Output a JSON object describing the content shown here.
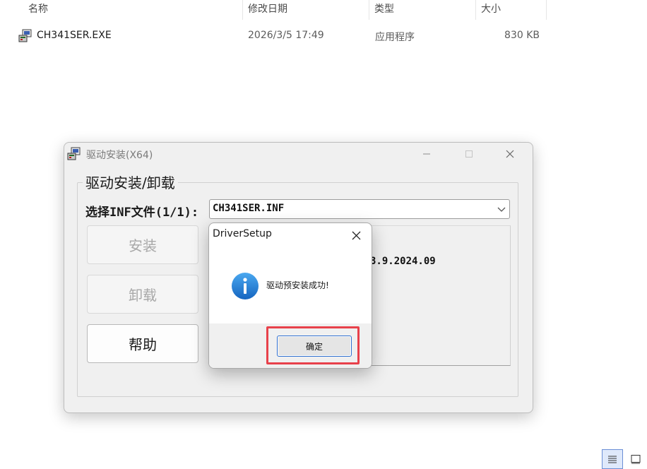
{
  "explorer": {
    "columns": {
      "name": "名称",
      "modified": "修改日期",
      "type": "类型",
      "size": "大小"
    },
    "file": {
      "name": "CH341SER.EXE",
      "modified": "2026/3/5 17:49",
      "type": "应用程序",
      "size": "830 KB"
    }
  },
  "installer": {
    "title": "驱动安装(X64)",
    "group_title": "驱动安装/卸载",
    "inf_label": "选择INF文件(1/1):",
    "inf_selected": "CH341SER.INF",
    "buttons": {
      "install": "安装",
      "uninstall": "卸载",
      "help": "帮助"
    },
    "version_text": "3.9.2024.09"
  },
  "dialog": {
    "title": "DriverSetup",
    "message": "驱动预安装成功!",
    "ok_label": "确定"
  },
  "colors": {
    "highlight": "#e8414b",
    "info_icon": "#1a7fd6",
    "focus_border": "#2f6fd0"
  },
  "icons": {
    "file": "installer-exe-icon",
    "window": "installer-app-icon",
    "dialog": "info-icon"
  }
}
